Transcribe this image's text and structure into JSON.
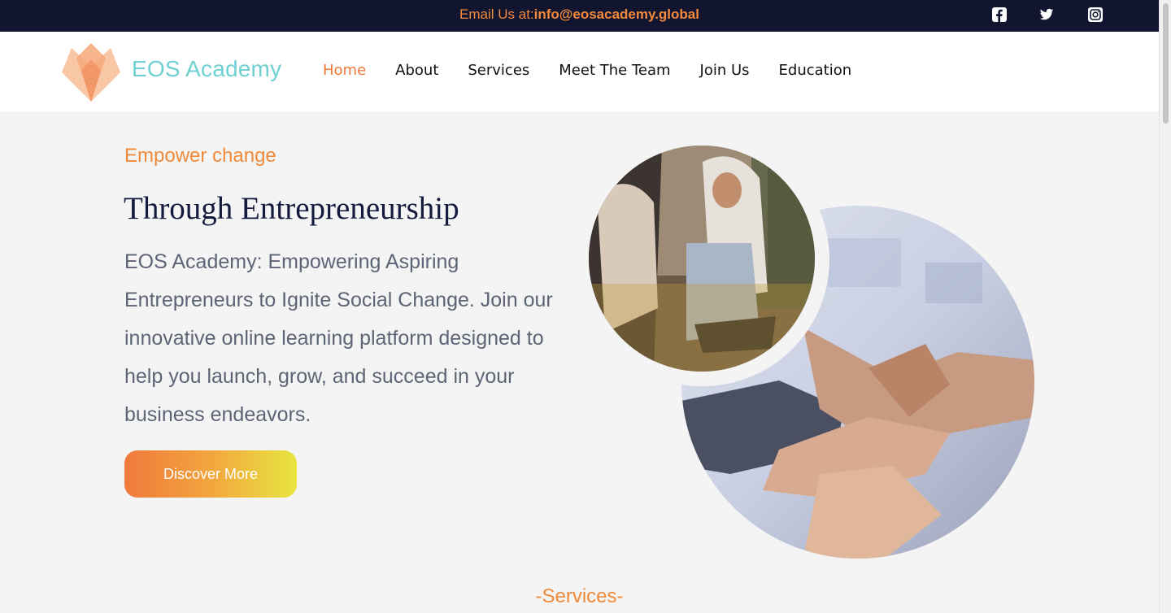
{
  "topbar": {
    "email_prefix": "Email Us at:",
    "email_address": "info@eosacademy.global",
    "social": [
      "facebook-icon",
      "twitter-icon",
      "instagram-icon"
    ]
  },
  "brand": {
    "name": "EOS Academy"
  },
  "nav": {
    "items": [
      {
        "label": "Home",
        "active": true
      },
      {
        "label": "About"
      },
      {
        "label": "Services"
      },
      {
        "label": "Meet The Team"
      },
      {
        "label": "Join Us"
      },
      {
        "label": "Education"
      }
    ]
  },
  "hero": {
    "eyebrow": "Empower change",
    "headline": "Through Entrepreneurship",
    "description": "EOS Academy: Empowering Aspiring Entrepreneurs to Ignite Social Change. Join our innovative online learning platform designed to help you launch, grow, and succeed in your business endeavors.",
    "cta_label": "Discover More"
  },
  "sections": {
    "services_heading": "-Services-"
  },
  "colors": {
    "accent": "#ef7a3a",
    "navy": "#12152f",
    "brand_teal": "#6fd0d2"
  }
}
